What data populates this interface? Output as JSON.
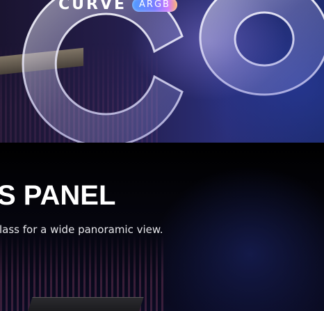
{
  "banner": {
    "logo": {
      "word": "CURVE",
      "badge": "ARGB"
    }
  },
  "section": {
    "headline": "S PANEL",
    "description": "lass for a wide panoramic view."
  },
  "colors": {
    "badge_gradient": [
      "#4f9cff",
      "#7a7dff",
      "#d07cff",
      "#ffb067"
    ],
    "banner_background": "#241d4a",
    "lower_background": "#000000",
    "text": "#ffffff"
  }
}
